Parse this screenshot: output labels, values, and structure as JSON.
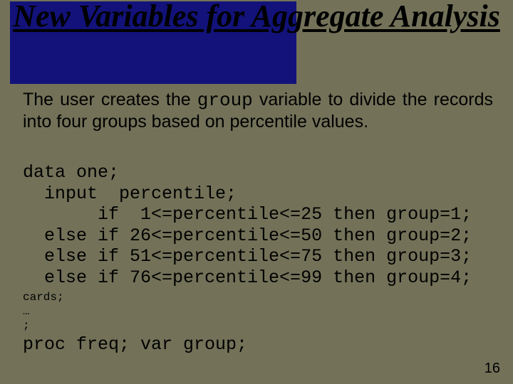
{
  "title": "New Variables for Aggregate Analysis",
  "paragraph": {
    "pre": "The user creates the ",
    "mono": "group",
    "post": " variable to divide the records into four groups based on percentile values."
  },
  "code1": "data one;\n  input  percentile;\n       if  1<=percentile<=25 then group=1;\n  else if 26<=percentile<=50 then group=2;\n  else if 51<=percentile<=75 then group=3;\n  else if 76<=percentile<=99 then group=4;",
  "code_small": "cards;\n…\n;",
  "code2": "proc freq; var group;",
  "page_number": "16"
}
